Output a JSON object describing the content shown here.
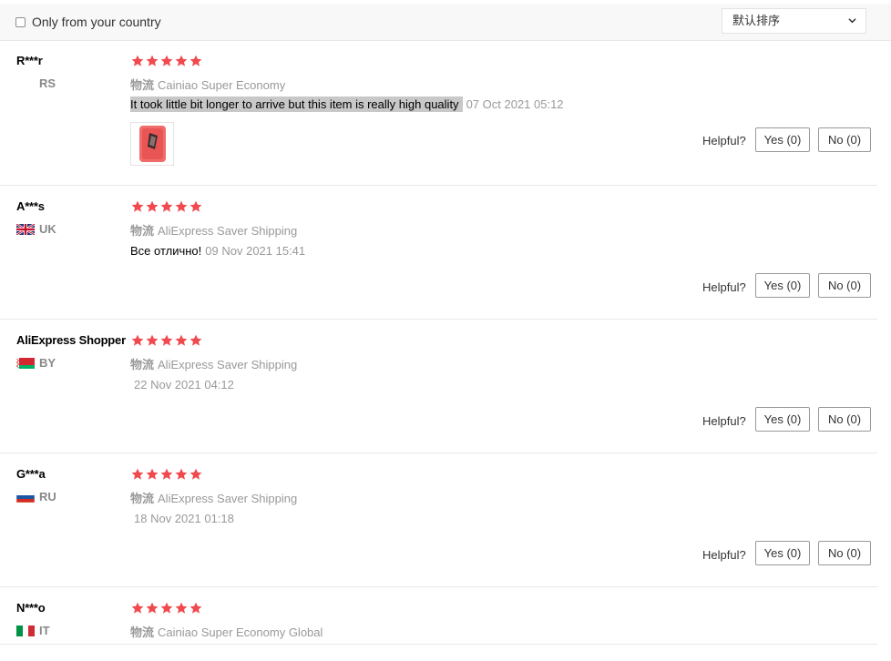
{
  "filter": {
    "country_label": "Only from your country",
    "sort_value": "默认排序"
  },
  "colors": {
    "star": "#f0494e",
    "highlight": "#c8c8c8"
  },
  "shipping_prefix": "物流",
  "helpful_label": "Helpful?",
  "reviews": [
    {
      "name": "R***r",
      "country": "RS",
      "flag": null,
      "rating": 5,
      "shipping": "Cainiao Super Economy",
      "text": "It took little bit longer to arrive but this item is really high quality",
      "date": "07 Oct 2021 05:12",
      "has_photo": true,
      "yes": "Yes (0)",
      "no": "No (0)"
    },
    {
      "name": "A***s",
      "country": "UK",
      "flag": "gb-flag-icon",
      "rating": 5,
      "shipping": "AliExpress Saver Shipping",
      "text": "Все отлично!",
      "date": "09 Nov 2021 15:41",
      "has_photo": false,
      "yes": "Yes (0)",
      "no": "No (0)"
    },
    {
      "name": "AliExpress Shopper",
      "country": "BY",
      "flag": "by-flag-icon",
      "rating": 5,
      "shipping": "AliExpress Saver Shipping",
      "text": "",
      "date": "22 Nov 2021 04:12",
      "has_photo": false,
      "yes": "Yes (0)",
      "no": "No (0)"
    },
    {
      "name": "G***a",
      "country": "RU",
      "flag": "ru-flag-icon",
      "rating": 5,
      "shipping": "AliExpress Saver Shipping",
      "text": "",
      "date": "18 Nov 2021 01:18",
      "has_photo": false,
      "yes": "Yes (0)",
      "no": "No (0)"
    },
    {
      "name": "N***o",
      "country": "IT",
      "flag": "it-flag-icon",
      "rating": 5,
      "shipping": "Cainiao Super Economy Global",
      "text": "",
      "date": "",
      "has_photo": false,
      "yes": "",
      "no": ""
    }
  ]
}
